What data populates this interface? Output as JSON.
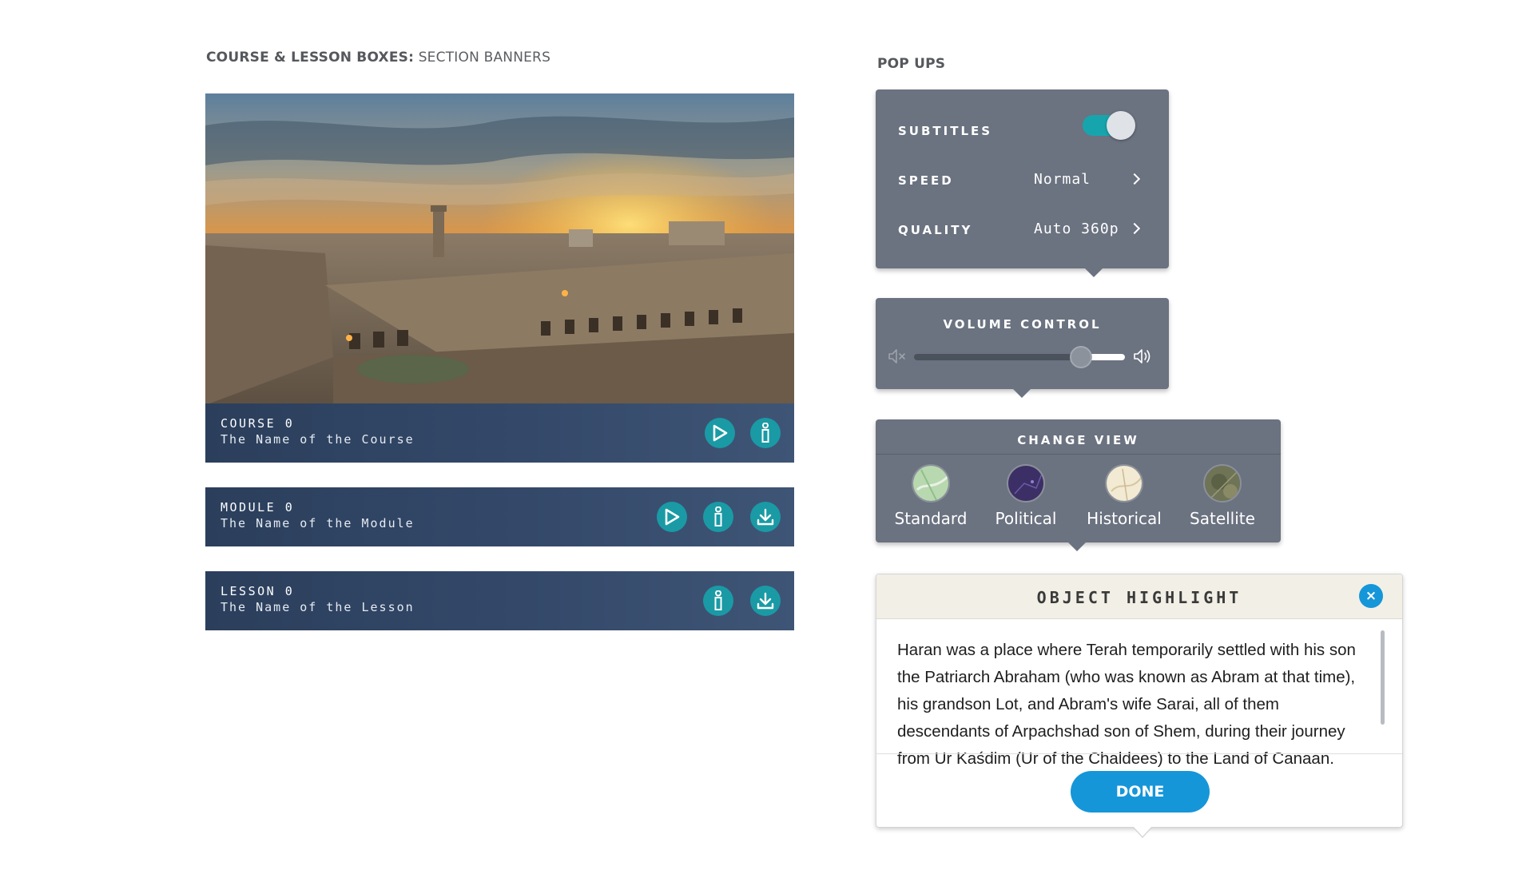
{
  "left": {
    "heading_bold": "COURSE & LESSON BOXES:",
    "heading_rest": "SECTION BANNERS",
    "hero_image": "jerusalem-citadel-sunset-photo",
    "banners": [
      {
        "kicker": "COURSE 0",
        "name": "The Name of the Course",
        "buttons": [
          "play",
          "info"
        ]
      },
      {
        "kicker": "MODULE 0",
        "name": "The Name of the Module",
        "buttons": [
          "play",
          "info",
          "download"
        ]
      },
      {
        "kicker": "LESSON 0",
        "name": "The Name of the Lesson",
        "buttons": [
          "info",
          "download"
        ]
      }
    ]
  },
  "right": {
    "heading": "POP UPS",
    "settings": {
      "subtitles_label": "SUBTITLES",
      "subtitles_on": true,
      "speed_label": "SPEED",
      "speed_value": "Normal",
      "quality_label": "QUALITY",
      "quality_value": "Auto 360p"
    },
    "volume": {
      "title": "VOLUME CONTROL",
      "level": 0.79
    },
    "change_view": {
      "title": "CHANGE VIEW",
      "options": [
        {
          "label": "Standard",
          "icon": "standard-map-thumb"
        },
        {
          "label": "Political",
          "icon": "political-map-thumb"
        },
        {
          "label": "Historical",
          "icon": "historical-map-thumb"
        },
        {
          "label": "Satellite",
          "icon": "satellite-map-thumb"
        }
      ]
    },
    "object_highlight": {
      "title": "OBJECT HIGHLIGHT",
      "close": "×",
      "body": "Haran was a place where Terah temporarily settled with his son the Patriarch Abraham (who was known as Abram at that time), his grandson Lot, and Abram's wife Sarai, all of them descendants of Arpachshad son of Shem, during their journey from Ur Kaśdim (Ur of the Chaldees) to the Land of Canaan.",
      "done": "DONE"
    }
  },
  "colors": {
    "banner": "#2b3f5c",
    "teal": "#1a9aa5",
    "popup": "#6b7280",
    "blue": "#1596d9"
  }
}
